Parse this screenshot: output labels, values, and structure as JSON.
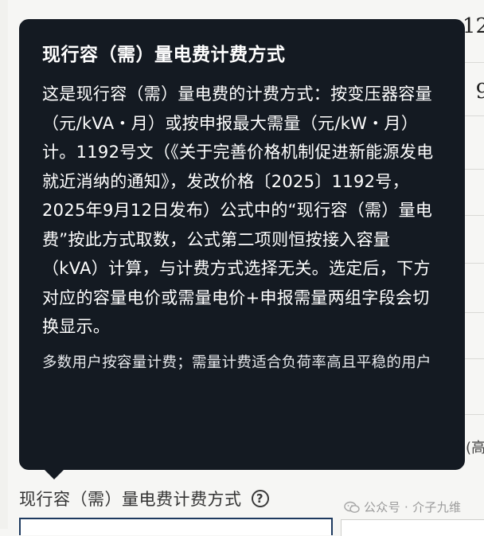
{
  "background": {
    "num1": "12",
    "num2": "9",
    "paren": "(高"
  },
  "tooltip": {
    "title": "现行容（需）量电费计费方式",
    "body": "这是现行容（需）量电费的计费方式：按变压器容量（元/kVA・月）或按申报最大需量（元/kW・月）计。1192号文（《关于完善价格机制促进新能源发电就近消纳的通知》，发改价格〔2025〕1192号，2025年9月12日发布）公式中的“现行容（需）量电费”按此方式取数，公式第二项则恒按接入容量（kVA）计算，与计费方式选择无关。选定后，下方对应的容量电价或需量电价+申报需量两组字段会切换显示。",
    "note": "多数用户按容量计费；需量计费适合负荷率高且平稳的用户"
  },
  "field": {
    "label": "现行容（需）量电费计费方式",
    "help_icon": "?"
  },
  "watermark": {
    "text": "公众号 · 介子九维"
  },
  "colors": {
    "tooltip_bg": "#141a22",
    "page_bg": "#f6f6f4",
    "select_border": "#1e3a5f"
  }
}
